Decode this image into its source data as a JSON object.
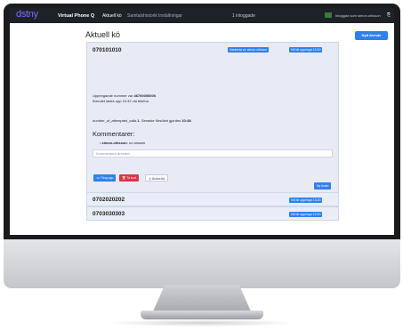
{
  "brand": "dstny",
  "app_title": "Virtual Phone Q",
  "nav": {
    "links": [
      "Aktuell kö",
      "Samtalshistorik",
      "Inställningar"
    ],
    "logged_in_count": "1 inloggade",
    "user": "Inloggad som simon.ohlsson"
  },
  "page_title": "Aktuell kö",
  "new_case_button": "Nytt ärende",
  "queue": [
    {
      "number": "070101010",
      "handled_by": "Hanteras av simon.ohlsson",
      "wants_callback": "Vill bli uppringd 13:10",
      "info_line1_prefix": "Uppringande nummer var ",
      "info_line1_value": "46700000000",
      "info_line2": "Ärendet lades upp 10:32 via telefon.",
      "attempts_prefix": "number_of_attempted_calls ",
      "attempts_value": "1",
      "attempts_mid": ". Senaste försöket gjordes ",
      "attempts_time": "10:38",
      "comments_heading": "Kommentarer:",
      "comment_author": "simon.ohlsson",
      "comment_text": ": no answer",
      "comment_placeholder": "Kommentera ärendet",
      "buttons": {
        "ring_upp": "Ring upp",
        "ta_bort": "Ta bort",
        "andra_tid": "Ändra tid"
      },
      "new_ticket": "Ny ticket"
    },
    {
      "number": "0702020202",
      "wants_callback": "Vill bli uppringd 13:20"
    },
    {
      "number": "0703030303",
      "wants_callback": "Vill bli uppringd 13:10"
    }
  ],
  "colors": {
    "accent": "#2f80ed",
    "danger": "#dc3545",
    "nav_bg": "#1e2128",
    "brand": "#7a6ef7"
  },
  "icons": [
    "phone-icon",
    "trash-icon",
    "clock-icon",
    "flag-icon",
    "logout-icon"
  ]
}
